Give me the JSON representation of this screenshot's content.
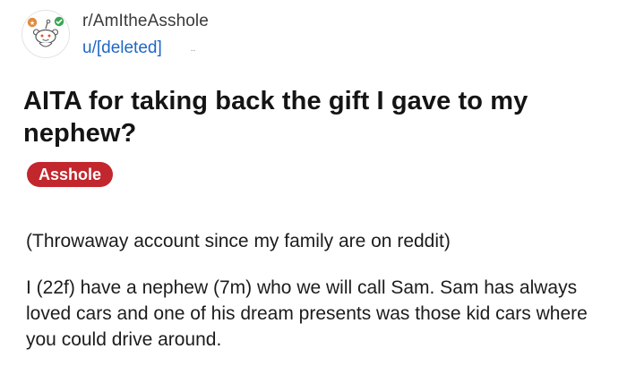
{
  "post": {
    "subreddit": "r/AmItheAsshole",
    "username": "u/[deleted]",
    "stray_mark": "..",
    "title": "AITA for taking back the gift I gave to my nephew?",
    "flair": "Asshole",
    "paragraphs": [
      "(Throwaway account since my family are on reddit)",
      "I (22f) have a nephew (7m) who we will call Sam. Sam has always loved cars and one of his dream presents was those kid cars where you could drive around."
    ]
  },
  "icons": {
    "avatar": "reddit-snoo-icon"
  },
  "colors": {
    "flair_background": "#c2272d",
    "username": "#1f67c5",
    "badge_green": "#3aa655",
    "badge_orange": "#e08b3d"
  }
}
